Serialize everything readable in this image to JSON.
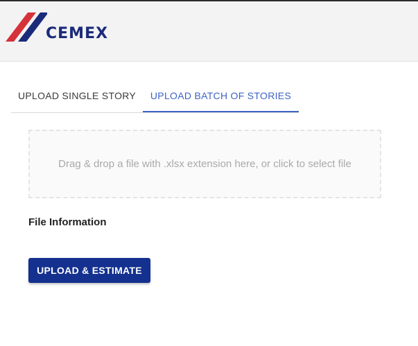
{
  "header": {
    "logo_text": "CEMEX",
    "logo_colors": {
      "stripe_red": "#d6323a",
      "stripe_blue": "#1b2b7a",
      "text": "#1b2b7a"
    }
  },
  "tabs": [
    {
      "label": "UPLOAD SINGLE STORY",
      "active": false
    },
    {
      "label": "UPLOAD BATCH OF STORIES",
      "active": true
    }
  ],
  "dropzone": {
    "text": "Drag & drop a file with .xlsx extension here, or click to select file"
  },
  "file_info": {
    "heading": "File Information"
  },
  "actions": {
    "upload_label": "UPLOAD & ESTIMATE"
  },
  "colors": {
    "accent": "#3d63c4",
    "button": "#14318f"
  }
}
